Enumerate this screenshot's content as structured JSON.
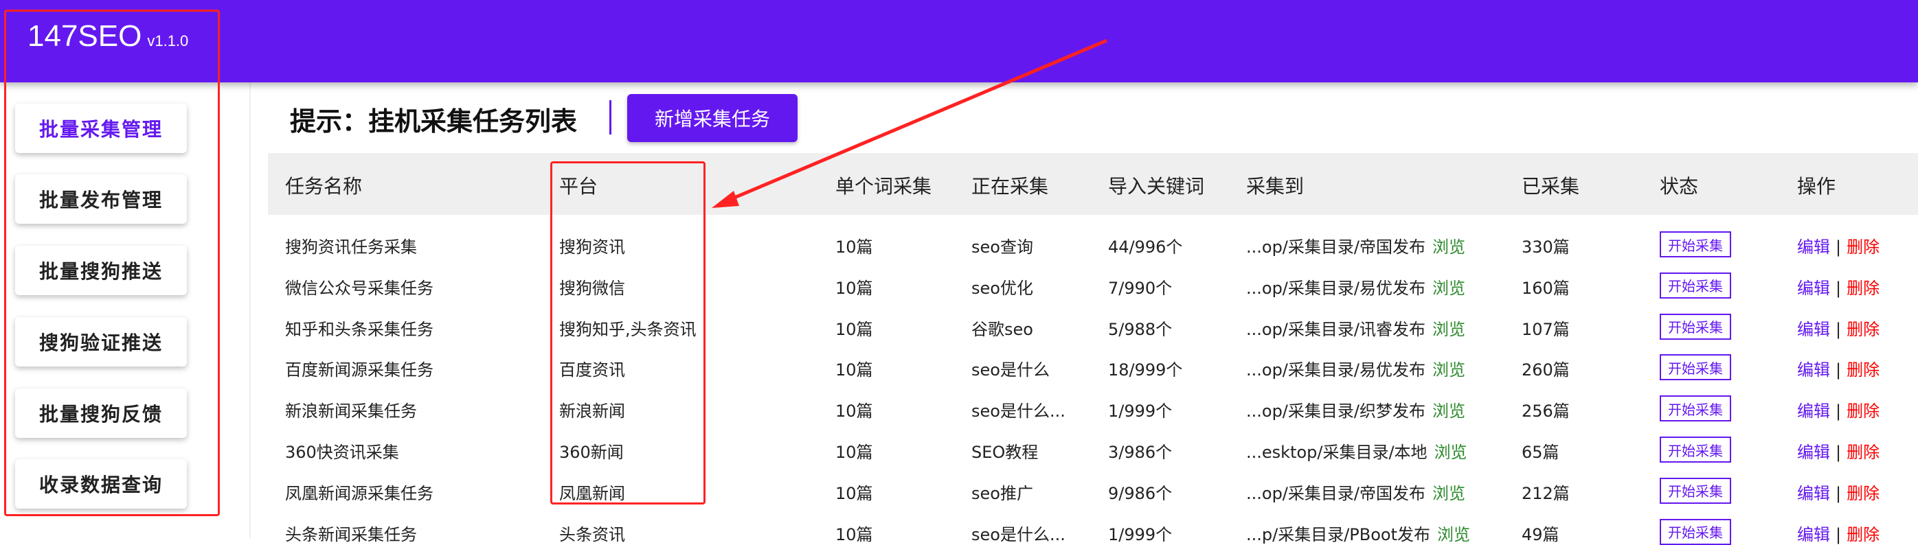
{
  "app": {
    "name": "147SEO",
    "version": "v1.1.0"
  },
  "sidebar": {
    "items": [
      {
        "label": "批量采集管理",
        "active": true
      },
      {
        "label": "批量发布管理"
      },
      {
        "label": "批量搜狗推送"
      },
      {
        "label": "搜狗验证推送"
      },
      {
        "label": "批量搜狗反馈"
      },
      {
        "label": "收录数据查询"
      }
    ]
  },
  "main": {
    "title": "提示：挂机采集任务列表",
    "add_button": "新增采集任务",
    "columns": [
      "任务名称",
      "平台",
      "单个词采集",
      "正在采集",
      "导入关键词",
      "采集到",
      "已采集",
      "状态",
      "操作"
    ],
    "browse_label": "浏览",
    "status_label": "开始采集",
    "edit_label": "编辑",
    "sep": "|",
    "delete_label": "删除",
    "rows": [
      {
        "name": "搜狗资讯任务采集",
        "platform": "搜狗资讯",
        "per": "10篇",
        "current": "seo查询",
        "keywords": "44/996个",
        "dest": "...op/采集目录/帝国发布",
        "collected": "330篇"
      },
      {
        "name": "微信公众号采集任务",
        "platform": "搜狗微信",
        "per": "10篇",
        "current": "seo优化",
        "keywords": "7/990个",
        "dest": "...op/采集目录/易优发布",
        "collected": "160篇"
      },
      {
        "name": "知乎和头条采集任务",
        "platform": "搜狗知乎,头条资讯",
        "per": "10篇",
        "current": "谷歌seo",
        "keywords": "5/988个",
        "dest": "...op/采集目录/讯睿发布",
        "collected": "107篇"
      },
      {
        "name": "百度新闻源采集任务",
        "platform": "百度资讯",
        "per": "10篇",
        "current": "seo是什么",
        "keywords": "18/999个",
        "dest": "...op/采集目录/易优发布",
        "collected": "260篇"
      },
      {
        "name": "新浪新闻采集任务",
        "platform": "新浪新闻",
        "per": "10篇",
        "current": "seo是什么...",
        "keywords": "1/999个",
        "dest": "...op/采集目录/织梦发布",
        "collected": "256篇"
      },
      {
        "name": "360快资讯采集",
        "platform": "360新闻",
        "per": "10篇",
        "current": "SEO教程",
        "keywords": "3/986个",
        "dest": "...esktop/采集目录/本地",
        "collected": "65篇"
      },
      {
        "name": "凤凰新闻源采集任务",
        "platform": "凤凰新闻",
        "per": "10篇",
        "current": "seo推广",
        "keywords": "9/986个",
        "dest": "...op/采集目录/帝国发布",
        "collected": "212篇"
      },
      {
        "name": "头条新闻采集任务",
        "platform": "头条资讯",
        "per": "10篇",
        "current": "seo是什么...",
        "keywords": "1/999个",
        "dest": "...p/采集目录/PBoot发布",
        "collected": "49篇"
      }
    ]
  },
  "colors": {
    "brand": "#6418f0",
    "browse": "#2e8b2e",
    "delete": "#ff0000",
    "annotation": "#ff2222"
  }
}
